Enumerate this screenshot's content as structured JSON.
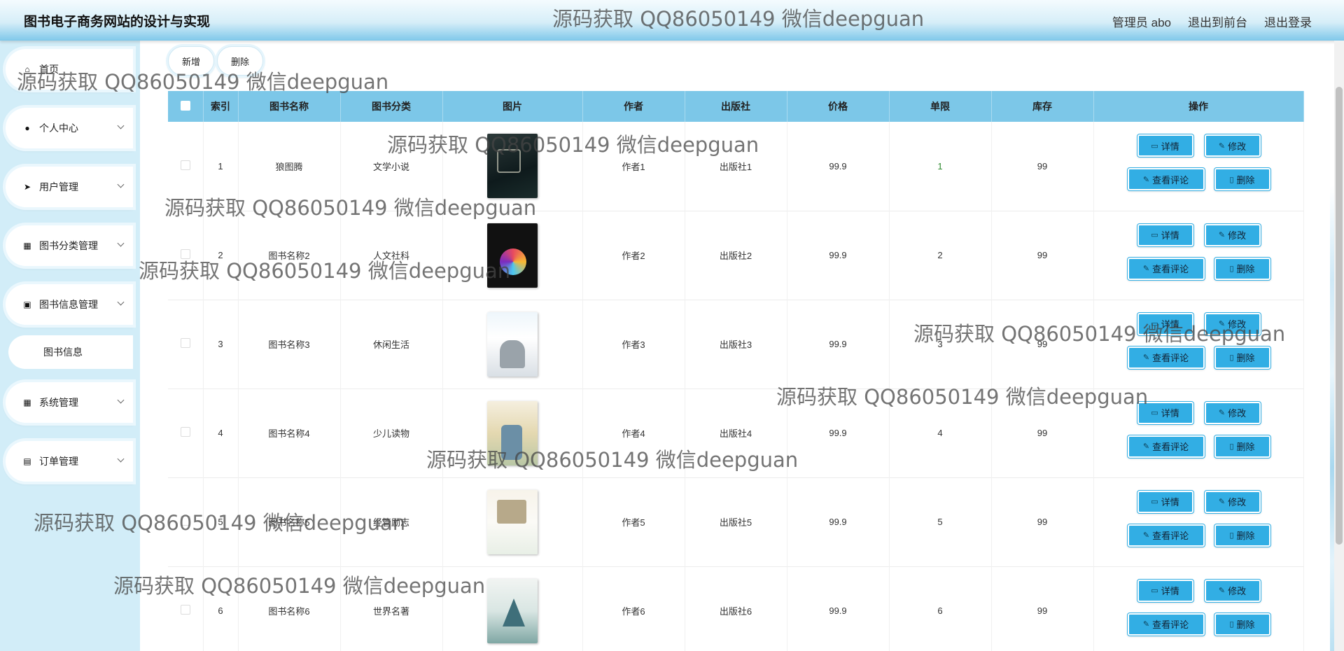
{
  "header": {
    "title": "图书电子商务网站的设计与实现",
    "admin": "管理员 abo",
    "front_link": "退出到前台",
    "logout_link": "退出登录"
  },
  "sidebar": {
    "items": [
      {
        "label": "首页",
        "icon": "home-icon"
      },
      {
        "label": "个人中心",
        "icon": "user-icon"
      },
      {
        "label": "用户管理",
        "icon": "send-icon"
      },
      {
        "label": "图书分类管理",
        "icon": "grid-icon"
      },
      {
        "label": "图书信息管理",
        "icon": "briefcase-icon"
      },
      {
        "label": "图书信息",
        "icon": ""
      },
      {
        "label": "系统管理",
        "icon": "apps-icon"
      },
      {
        "label": "订单管理",
        "icon": "clipboard-icon"
      }
    ]
  },
  "toolbar": {
    "add_label": "新增",
    "delete_label": "删除"
  },
  "table": {
    "headers": [
      "索引",
      "图书名称",
      "图书分类",
      "图片",
      "作者",
      "出版社",
      "价格",
      "单限",
      "库存",
      "操作"
    ],
    "rows": [
      {
        "index": "1",
        "name": "狼图腾",
        "category": "文学小说",
        "author": "作者1",
        "publisher": "出版社1",
        "price": "99.9",
        "limit": "1",
        "stock": "99"
      },
      {
        "index": "2",
        "name": "图书名称2",
        "category": "人文社科",
        "author": "作者2",
        "publisher": "出版社2",
        "price": "99.9",
        "limit": "2",
        "stock": "99"
      },
      {
        "index": "3",
        "name": "图书名称3",
        "category": "休闲生活",
        "author": "作者3",
        "publisher": "出版社3",
        "price": "99.9",
        "limit": "3",
        "stock": "99"
      },
      {
        "index": "4",
        "name": "图书名称4",
        "category": "少儿读物",
        "author": "作者4",
        "publisher": "出版社4",
        "price": "99.9",
        "limit": "4",
        "stock": "99"
      },
      {
        "index": "5",
        "name": "图书名称5",
        "category": "经管励志",
        "author": "作者5",
        "publisher": "出版社5",
        "price": "99.9",
        "limit": "5",
        "stock": "99"
      },
      {
        "index": "6",
        "name": "图书名称6",
        "category": "世界名著",
        "author": "作者6",
        "publisher": "出版社6",
        "price": "99.9",
        "limit": "6",
        "stock": "99"
      }
    ],
    "ops": {
      "detail": "详情",
      "edit": "修改",
      "review": "查看评论",
      "delete": "删除"
    }
  },
  "watermark": "源码获取 QQ86050149 微信deepguan",
  "colors": {
    "header_accent": "#7fc8ea",
    "table_header": "#7cc7e8",
    "op_button": "#32aee4",
    "sidebar_bg": "#d2edf8"
  }
}
